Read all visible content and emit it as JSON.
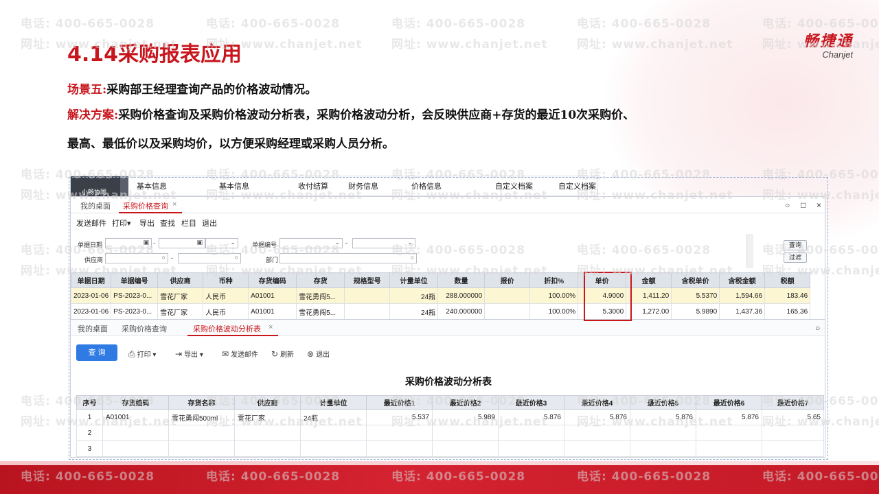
{
  "watermark": {
    "phone": "电话: 400-665-0028",
    "site": "网址: www.chanjet.net"
  },
  "slide": {
    "title": "4.14采购报表应用",
    "logo_cn": "畅捷通",
    "logo_en": "Chanjet",
    "scene_label": "场景五:",
    "scene_text": "采购部王经理查询产品的价格波动情况。",
    "solution_label": "解决方案:",
    "solution_text": "采购价格查询及采购价格波动分析表，采购价格波动分析，会反映供应商+存货的最近10次采购价、",
    "solution_text2": "最高、最低价以及采购均价，以方便采购经理或采购人员分析。"
  },
  "topbar": {
    "brand": "小畅协同",
    "menus": [
      "基本信息",
      "基本信息",
      "收付结算",
      "财务信息",
      "价格信息",
      "自定义档案",
      "自定义档案"
    ]
  },
  "window1": {
    "tabs": [
      "我的桌面",
      "采购价格查询"
    ],
    "tab_close": "×",
    "controls": {
      "search": "○",
      "maximize": "□",
      "close": "×"
    },
    "toolbar": [
      "发送邮件",
      "打印▾",
      "导出",
      "查找",
      "栏目",
      "退出"
    ],
    "filters": {
      "doc_date": "单据日期",
      "supplier": "供应商",
      "doc_no": "单据编号",
      "dept": "部门",
      "dash": "-",
      "query_btn": "查询",
      "filter_btn": "过滤"
    },
    "columns": [
      "单据日期",
      "单据编号",
      "供应商",
      "币种",
      "存货编码",
      "存货",
      "规格型号",
      "计量单位",
      "数量",
      "报价",
      "折扣%",
      "单价",
      "金额",
      "含税单价",
      "含税金额",
      "税额"
    ],
    "rows": [
      [
        "2023-01-06",
        "PS-2023-0...",
        "雪花厂家",
        "人民币",
        "A01001",
        "雪花勇闯5...",
        "",
        "24瓶",
        "288.000000",
        "",
        "100.00%",
        "4.9000",
        "1,411.20",
        "5.5370",
        "1,594.66",
        "183.46"
      ],
      [
        "2023-01-06",
        "PS-2023-0...",
        "雪花厂家",
        "人民币",
        "A01001",
        "雪花勇闯5...",
        "",
        "24瓶",
        "240.000000",
        "",
        "100.00%",
        "5.3000",
        "1,272.00",
        "5.9890",
        "1,437.36",
        "165.36"
      ]
    ]
  },
  "window2": {
    "tabs": [
      "我的桌面",
      "采购价格查询",
      "采购价格波动分析表"
    ],
    "tab_close": "×",
    "search_icon": "○",
    "query_btn": "查 询",
    "toolbar": [
      {
        "icon": "⎙",
        "label": "打印 ▾"
      },
      {
        "icon": "⇥",
        "label": "导出 ▾"
      },
      {
        "icon": "✉",
        "label": "发送邮件"
      },
      {
        "icon": "↻",
        "label": "刷新"
      },
      {
        "icon": "⊗",
        "label": "退出"
      }
    ],
    "report_title": "采购价格波动分析表",
    "columns": [
      "序号",
      "存货编码",
      "存货名称",
      "供应商",
      "计量单位",
      "最近价格1",
      "最近价格2",
      "最近价格3",
      "最近价格4",
      "最近价格5",
      "最近价格6",
      "最近价格7"
    ],
    "rows": [
      [
        "1",
        "A01001",
        "雪花勇闯500ml",
        "雪花厂家",
        "24瓶",
        "5.537",
        "5.989",
        "5.876",
        "5.876",
        "5.876",
        "5.876",
        "5.65"
      ],
      [
        "2",
        "",
        "",
        "",
        "",
        "",
        "",
        "",
        "",
        "",
        "",
        ""
      ],
      [
        "3",
        "",
        "",
        "",
        "",
        "",
        "",
        "",
        "",
        "",
        "",
        ""
      ]
    ]
  },
  "colors": {
    "accent": "#c8161d",
    "query_blue": "#2f7be3",
    "selected_row": "#fdf6d3"
  }
}
